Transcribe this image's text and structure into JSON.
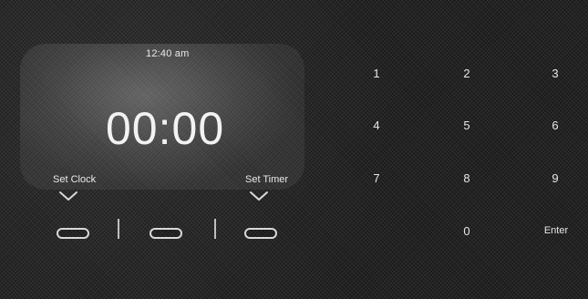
{
  "display": {
    "clock": "12:40 am",
    "time": "00:00"
  },
  "actions": {
    "set_clock": "Set Clock",
    "set_timer": "Set Timer"
  },
  "keypad": {
    "rows": [
      [
        "1",
        "2",
        "3"
      ],
      [
        "4",
        "5",
        "6"
      ],
      [
        "7",
        "8",
        "9"
      ],
      [
        "",
        "0",
        "Enter"
      ]
    ]
  },
  "icons": {
    "chevron": "chevron-down-icon"
  },
  "colors": {
    "background": "#1b1b1b",
    "foreground": "#f2f2f2",
    "accent": "#d9d9d9"
  }
}
